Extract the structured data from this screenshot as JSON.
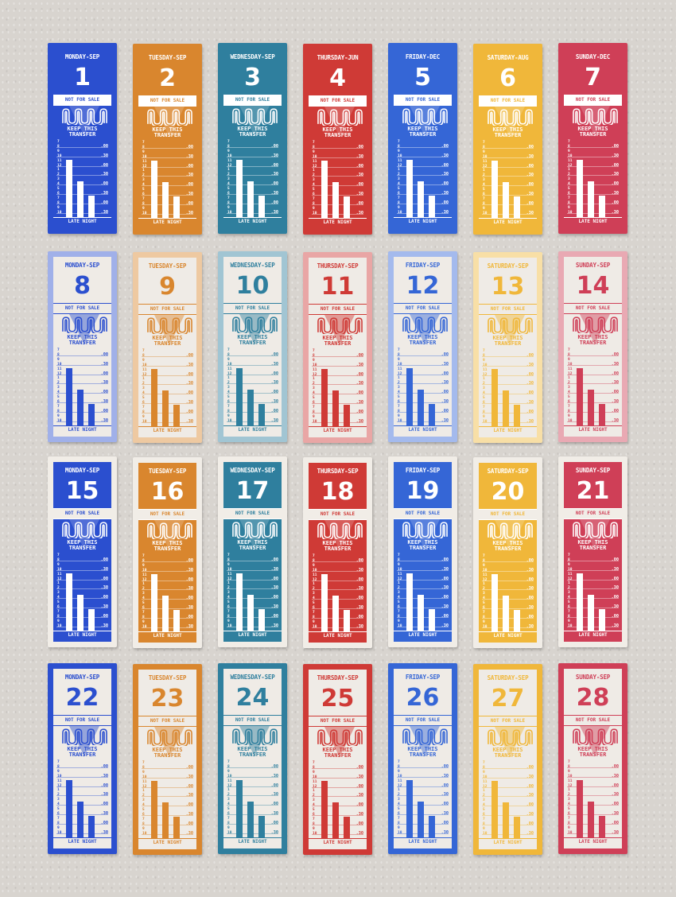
{
  "labels": {
    "not_for_sale": "NOT FOR SALE",
    "keep_line1": "KEEP THIS",
    "keep_line2": "TRANSFER",
    "late_night": "LATE NIGHT",
    "hour_ticks": [
      "7",
      "8",
      "9",
      "10",
      "11",
      "12",
      "1",
      "2",
      "3",
      "4",
      "5",
      "6",
      "7",
      "8",
      "9",
      "10"
    ],
    "minute_ticks": [
      ".00",
      ".30",
      ".00",
      ".30",
      ".00",
      ".30",
      ".00",
      ".30"
    ]
  },
  "bar_levels": [
    1.0,
    0.62,
    0.38
  ],
  "palette": {
    "blue": "#2b4fcf",
    "orange": "#d9862e",
    "teal": "#2f7f9e",
    "red": "#cf3a36",
    "royal": "#3566d6",
    "gold": "#f0b73a",
    "crimson": "#cf3f57"
  },
  "rows": [
    {
      "style": "solid",
      "tickets": [
        {
          "day": "MONDAY-SEP",
          "date": "1",
          "color": "blue"
        },
        {
          "day": "TUESDAY-SEP",
          "date": "2",
          "color": "orange"
        },
        {
          "day": "WEDNESDAY-SEP",
          "date": "3",
          "color": "teal"
        },
        {
          "day": "THURSDAY-JUN",
          "date": "4",
          "color": "red"
        },
        {
          "day": "FRIDAY-DEC",
          "date": "5",
          "color": "royal"
        },
        {
          "day": "SATURDAY-AUG",
          "date": "6",
          "color": "gold"
        },
        {
          "day": "SUNDAY-DEC",
          "date": "7",
          "color": "crimson"
        }
      ]
    },
    {
      "style": "light",
      "tickets": [
        {
          "day": "MONDAY-SEP",
          "date": "8",
          "color": "blue"
        },
        {
          "day": "TUESDAY-SEP",
          "date": "9",
          "color": "orange"
        },
        {
          "day": "WEDNESDAY-SEP",
          "date": "10",
          "color": "teal"
        },
        {
          "day": "THURSDAY-SEP",
          "date": "11",
          "color": "red"
        },
        {
          "day": "FRIDAY-SEP",
          "date": "12",
          "color": "royal"
        },
        {
          "day": "SATURDAY-SEP",
          "date": "13",
          "color": "gold"
        },
        {
          "day": "SUNDAY-SEP",
          "date": "14",
          "color": "crimson"
        }
      ]
    },
    {
      "style": "framed",
      "tickets": [
        {
          "day": "MONDAY-SEP",
          "date": "15",
          "color": "blue"
        },
        {
          "day": "TUESDAY-SEP",
          "date": "16",
          "color": "orange"
        },
        {
          "day": "WEDNESDAY-SEP",
          "date": "17",
          "color": "teal"
        },
        {
          "day": "THURSDAY-SEP",
          "date": "18",
          "color": "red"
        },
        {
          "day": "FRIDAY-SEP",
          "date": "19",
          "color": "royal"
        },
        {
          "day": "SATURDAY-SEP",
          "date": "20",
          "color": "gold"
        },
        {
          "day": "SUNDAY-SEP",
          "date": "21",
          "color": "crimson"
        }
      ]
    },
    {
      "style": "outline",
      "tickets": [
        {
          "day": "MONDAY-SEP",
          "date": "22",
          "color": "blue"
        },
        {
          "day": "TUESDAY-SEP",
          "date": "23",
          "color": "orange"
        },
        {
          "day": "WEDNESDAY-SEP",
          "date": "24",
          "color": "teal"
        },
        {
          "day": "THURSDAY-SEP",
          "date": "25",
          "color": "red"
        },
        {
          "day": "FRIDAY-SEP",
          "date": "26",
          "color": "royal"
        },
        {
          "day": "SATURDAY-SEP",
          "date": "27",
          "color": "gold"
        },
        {
          "day": "SUNDAY-SEP",
          "date": "28",
          "color": "crimson"
        }
      ]
    }
  ]
}
